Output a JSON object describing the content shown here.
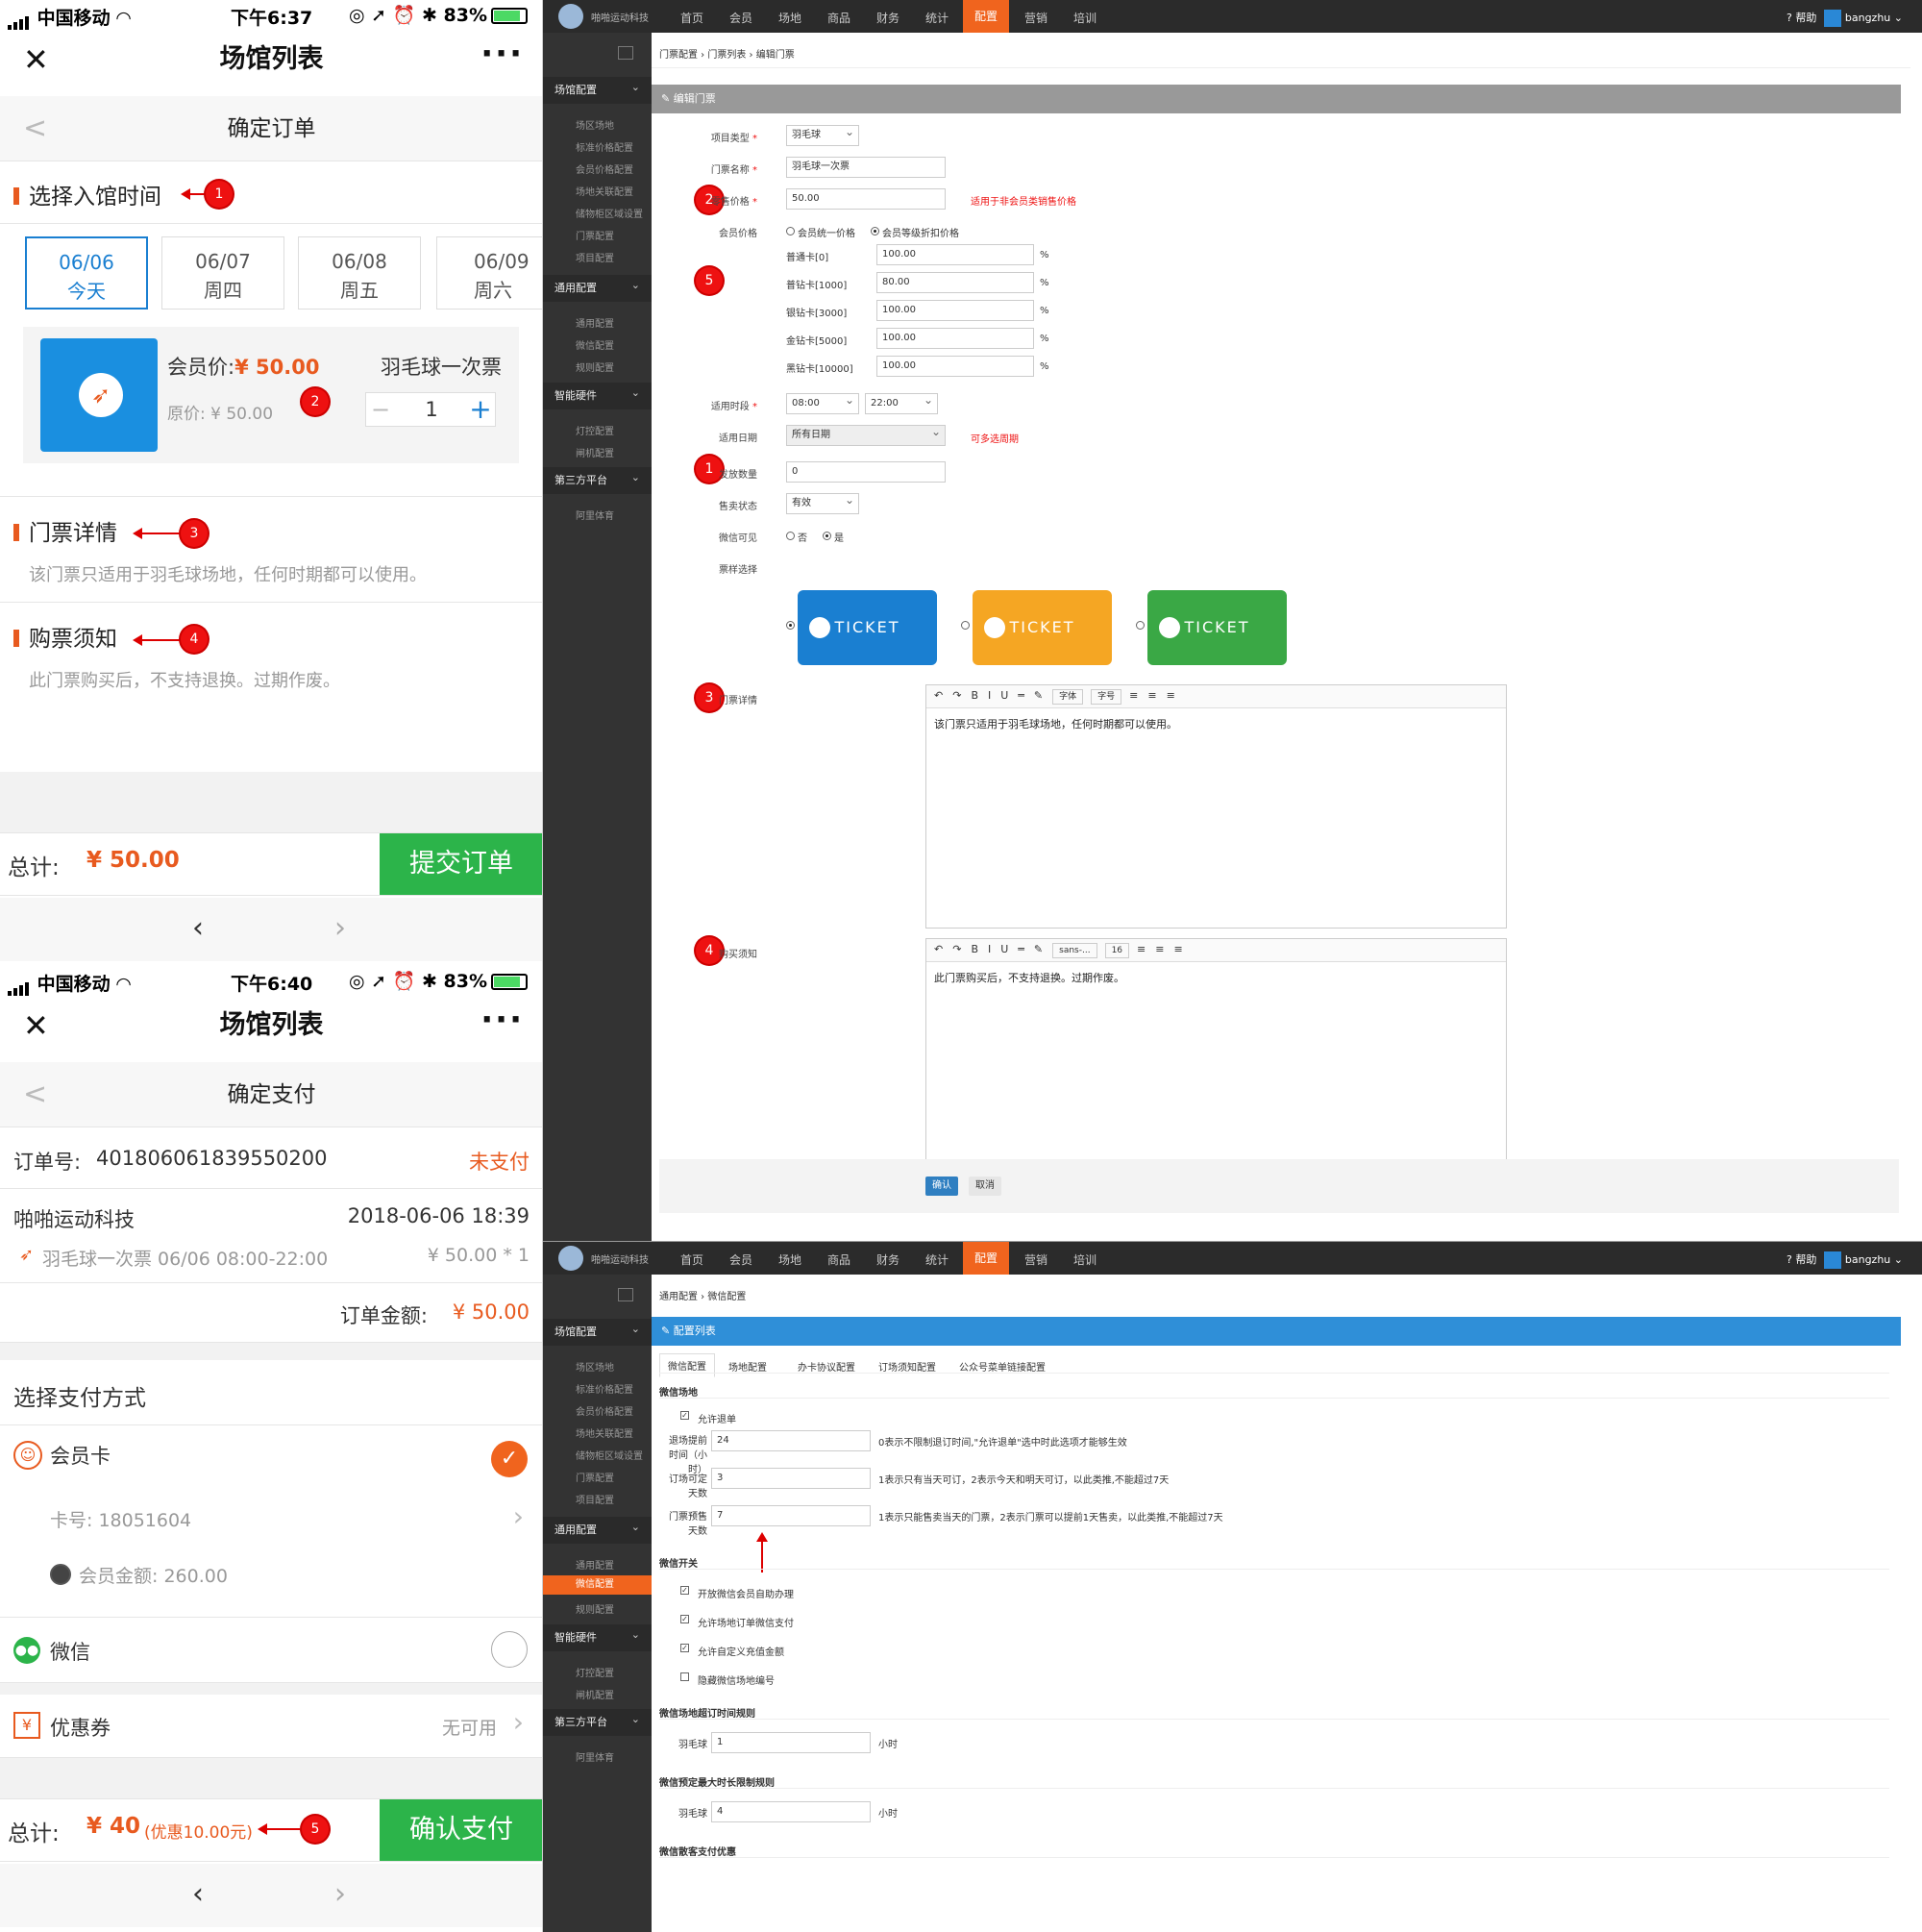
{
  "phone1": {
    "status": {
      "carrier": "中国移动",
      "time": "下午6:37",
      "battery": "83%"
    },
    "title": "场馆列表",
    "nav_title": "确定订单",
    "section_time": "选择入馆时间",
    "dates": [
      {
        "date": "06/06",
        "day": "今天"
      },
      {
        "date": "06/07",
        "day": "周四"
      },
      {
        "date": "06/08",
        "day": "周五"
      },
      {
        "date": "06/09",
        "day": "周六"
      }
    ],
    "member_price_label": "会员价:",
    "member_price": "¥ 50.00",
    "orig_price": "原价: ¥ 50.00",
    "ticket_name": "羽毛球一次票",
    "qty": "1",
    "section_detail": "门票详情",
    "detail_text": "该门票只适用于羽毛球场地，任何时期都可以使用。",
    "section_notice": "购票须知",
    "notice_text": "此门票购买后，不支持退换。过期作废。",
    "total_label": "总计:",
    "total": "¥ 50.00",
    "submit": "提交订单"
  },
  "phone2": {
    "status": {
      "carrier": "中国移动",
      "time": "下午6:40",
      "battery": "83%"
    },
    "title": "场馆列表",
    "nav_title": "确定支付",
    "order_no_label": "订单号:",
    "order_no": "401806061839550200",
    "order_status": "未支付",
    "merchant": "啪啪运动科技",
    "order_time": "2018-06-06 18:39",
    "item": "羽毛球一次票 06/06 08:00-22:00",
    "item_price": "¥ 50.00 * 1",
    "order_amount_label": "订单金额:",
    "order_amount": "¥ 50.00",
    "pay_method_title": "选择支付方式",
    "member_card": "会员卡",
    "card_no": "卡号: 18051604",
    "card_balance": "会员金额: 260.00",
    "wechat": "微信",
    "coupon": "优惠券",
    "coupon_state": "无可用",
    "total_label": "总计:",
    "total": "¥ 40",
    "discount": "(优惠10.00元)",
    "confirm": "确认支付"
  },
  "annotations": [
    "1",
    "2",
    "3",
    "4",
    "5"
  ],
  "admin_nav": {
    "brand": "啪啪运动科技",
    "menus": [
      "首页",
      "会员",
      "场地",
      "商品",
      "财务",
      "统计",
      "配置",
      "营销",
      "培训"
    ],
    "active_menu": "配置",
    "help": "帮助",
    "user": "bangzhu"
  },
  "sidebar": {
    "groups": [
      {
        "label": "场馆配置",
        "items": [
          "场区场地",
          "标准价格配置",
          "会员价格配置",
          "场地关联配置",
          "储物柜区域设置",
          "门票配置",
          "项目配置"
        ]
      },
      {
        "label": "通用配置",
        "items": [
          "通用配置",
          "微信配置",
          "规则配置"
        ]
      },
      {
        "label": "智能硬件",
        "items": [
          "灯控配置",
          "闸机配置"
        ]
      },
      {
        "label": "第三方平台",
        "items": [
          "阿里体育"
        ]
      }
    ]
  },
  "admin1": {
    "crumb": "门票配置 › 门票列表 › 编辑门票",
    "panel_title": "编辑门票",
    "fields": {
      "type_label": "项目类型",
      "type_value": "羽毛球",
      "name_label": "门票名称",
      "name_value": "羽毛球一次票",
      "price_label": "零售价格",
      "price_value": "50.00",
      "price_hint": "适用于非会员类销售价格",
      "member_price_label": "会员价格",
      "member_opt1": "会员统一价格",
      "member_opt2": "会员等级折扣价格",
      "levels": [
        {
          "name": "普通卡[0]",
          "value": "100.00"
        },
        {
          "name": "普钻卡[1000]",
          "value": "80.00"
        },
        {
          "name": "银钻卡[3000]",
          "value": "100.00"
        },
        {
          "name": "金钻卡[5000]",
          "value": "100.00"
        },
        {
          "name": "黑钻卡[10000]",
          "value": "100.00"
        }
      ],
      "pct": "%",
      "period_label": "适用时段",
      "period_from": "08:00",
      "period_to": "22:00",
      "date_label": "适用日期",
      "date_value": "所有日期",
      "date_hint": "可多选周期",
      "count_label": "发放数量",
      "count_value": "0",
      "sale_label": "售卖状态",
      "sale_value": "有效",
      "wx_label": "微信可见",
      "wx_no": "否",
      "wx_yes": "是",
      "style_label": "票样选择",
      "ticket_text": "TICKET",
      "detail_label": "门票详情",
      "detail_text": "该门票只适用于羽毛球场地，任何时期都可以使用。",
      "font_label": "字体",
      "size_label": "字号",
      "notice_label": "购买须知",
      "notice_text": "此门票购买后，不支持退换。过期作废。",
      "font2": "sans-...",
      "size2": "16"
    },
    "confirm": "确认",
    "cancel": "取消",
    "ticket_colors": [
      "#1a7fd1",
      "#f5a623",
      "#3aa845"
    ]
  },
  "admin2": {
    "crumb": "通用配置 › 微信配置",
    "panel_title": "配置列表",
    "tabs": [
      "微信配置",
      "场地配置",
      "办卡协议配置",
      "订场须知配置",
      "公众号菜单链接配置"
    ],
    "sec1": "微信场地",
    "allow_refund": "允许退单",
    "refund_label": "退场提前时间（小时）",
    "refund_value": "24",
    "refund_hint": "0表示不限制退订时间,\"允许退单\"选中时此选项才能够生效",
    "book_label": "订场可定天数",
    "book_value": "3",
    "book_hint": "1表示只有当天可订，2表示今天和明天可订，以此类推,不能超过7天",
    "presale_label": "门票预售天数",
    "presale_value": "7",
    "presale_hint": "1表示只能售卖当天的门票，2表示门票可以提前1天售卖，以此类推,不能超过7天",
    "sec2": "微信开关",
    "switches": [
      {
        "label": "开放微信会员自助办理",
        "checked": true
      },
      {
        "label": "允许场地订单微信支付",
        "checked": true
      },
      {
        "label": "允许自定义充值金额",
        "checked": true
      },
      {
        "label": "隐藏微信场地编号",
        "checked": false
      }
    ],
    "sec3": "微信场地超订时间规则",
    "rule1_label": "羽毛球",
    "rule1_value": "1",
    "unit": "小时",
    "sec4": "微信预定最大时长限制规则",
    "rule2_label": "羽毛球",
    "rule2_value": "4",
    "sec5": "微信散客支付优惠"
  }
}
